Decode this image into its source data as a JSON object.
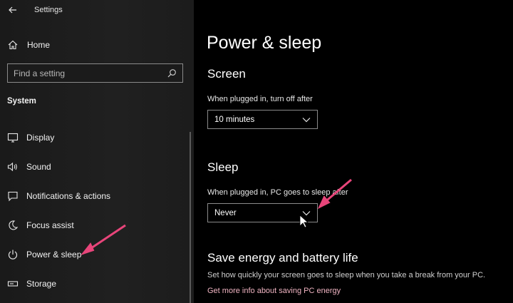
{
  "app": {
    "title": "Settings"
  },
  "sidebar": {
    "home_label": "Home",
    "search_placeholder": "Find a setting",
    "section_label": "System",
    "items": [
      {
        "label": "Display",
        "icon": "monitor-icon"
      },
      {
        "label": "Sound",
        "icon": "speaker-icon"
      },
      {
        "label": "Notifications & actions",
        "icon": "notification-icon"
      },
      {
        "label": "Focus assist",
        "icon": "moon-icon"
      },
      {
        "label": "Power & sleep",
        "icon": "power-icon"
      },
      {
        "label": "Storage",
        "icon": "storage-icon"
      }
    ]
  },
  "main": {
    "title": "Power & sleep",
    "screen": {
      "heading": "Screen",
      "label": "When plugged in, turn off after",
      "value": "10 minutes"
    },
    "sleep": {
      "heading": "Sleep",
      "label": "When plugged in, PC goes to sleep after",
      "value": "Never"
    },
    "energy": {
      "heading": "Save energy and battery life",
      "description": "Set how quickly your screen goes to sleep when you take a break from your PC.",
      "link": "Get more info about saving PC energy"
    }
  },
  "colors": {
    "annotation_arrow": "#e8457a",
    "link": "#f0b4c2"
  }
}
